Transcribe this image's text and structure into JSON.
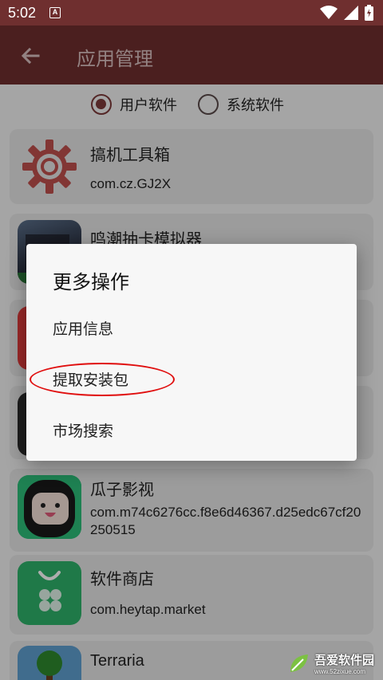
{
  "status_bar": {
    "time": "5:02",
    "notif_letter": "A"
  },
  "app_bar": {
    "title": "应用管理"
  },
  "filter": {
    "user_apps": "用户软件",
    "system_apps": "系统软件",
    "selected": "user_apps"
  },
  "apps": [
    {
      "name": "搞机工具箱",
      "package": "com.cz.GJ2X",
      "icon": "gear-icon"
    },
    {
      "name": "鸣潮抽卡模拟器",
      "package": "",
      "icon": "game-artwork-icon"
    },
    {
      "name": "",
      "package": "",
      "icon": "red-app-icon"
    },
    {
      "name": "",
      "package": "",
      "icon": "dark-app-icon"
    },
    {
      "name": "瓜子影视",
      "package": "com.m74c6276cc.f8e6d46367.d25edc67cf20250515",
      "icon": "cartoon-face-icon"
    },
    {
      "name": "软件商店",
      "package": "com.heytap.market",
      "icon": "store-bag-icon"
    },
    {
      "name": "Terraria",
      "package": "",
      "icon": "terraria-tree-icon"
    }
  ],
  "dialog": {
    "title": "更多操作",
    "items": [
      "应用信息",
      "提取安装包",
      "市场搜索"
    ],
    "highlighted_item": "提取安装包"
  },
  "watermark": {
    "text": "吾爱软件园",
    "url": "www.52zixue.com"
  },
  "colors": {
    "primary": "#6f2f2f",
    "accent": "#7d3a3a",
    "highlight": "#e00e0e",
    "store_green": "#2fb36b"
  }
}
